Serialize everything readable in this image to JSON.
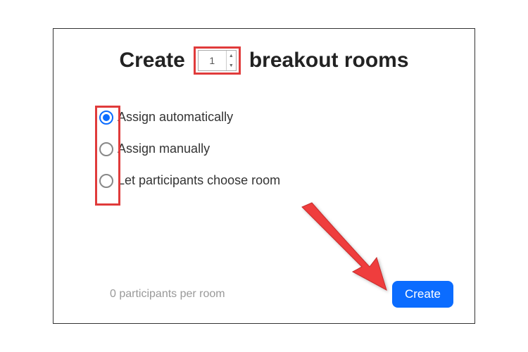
{
  "title": {
    "prefix": "Create",
    "suffix": "breakout rooms"
  },
  "room_count": "1",
  "options": [
    {
      "label": "Assign automatically",
      "selected": true
    },
    {
      "label": "Assign manually",
      "selected": false
    },
    {
      "label": "Let participants choose room",
      "selected": false
    }
  ],
  "footer": {
    "participants": "0 participants per room",
    "create_label": "Create"
  },
  "colors": {
    "highlight": "#e03b3b",
    "accent": "#0b6cff"
  }
}
